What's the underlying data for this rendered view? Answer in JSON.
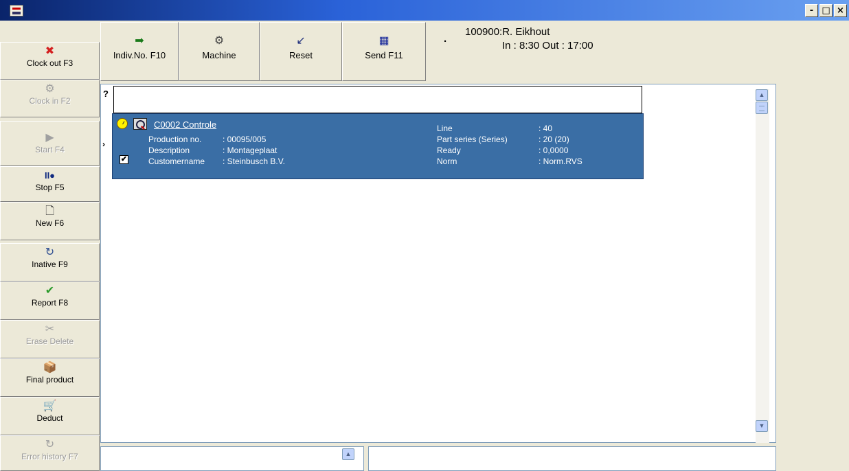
{
  "window": {
    "min_label": "-",
    "max_label": "□",
    "close_label": "×"
  },
  "sidebar": {
    "buttons": [
      {
        "label": "Clock out F3",
        "icon": "✖",
        "color": "#d42020",
        "enabled": true
      },
      {
        "label": "Clock in F2",
        "icon": "⚙",
        "color": "#a0a0a0",
        "enabled": false
      },
      {
        "label": "Start F4",
        "icon": "▶",
        "color": "#a0a0a0",
        "enabled": false
      },
      {
        "label": "Stop F5",
        "icon": "II●",
        "color": "#102a80",
        "enabled": true
      },
      {
        "label": "New F6",
        "icon": "🗋",
        "color": "#333333",
        "enabled": true
      },
      {
        "label": "Inative F9",
        "icon": "↻",
        "color": "#2a4a90",
        "enabled": true
      },
      {
        "label": "Report F8",
        "icon": "✔",
        "color": "#2a9a2a",
        "enabled": true
      },
      {
        "label": "Erase Delete",
        "icon": "✂",
        "color": "#a0a0a0",
        "enabled": false
      },
      {
        "label": "Final product",
        "icon": "📦",
        "color": "#333333",
        "enabled": true
      },
      {
        "label": "Deduct",
        "icon": "🛒",
        "color": "#333333",
        "enabled": true
      },
      {
        "label": "Error history F7",
        "icon": "↻",
        "color": "#a0a0a0",
        "enabled": false
      }
    ]
  },
  "toolbar": {
    "buttons": [
      {
        "label": "Indiv.No. F10",
        "icon": "➡",
        "color": "#1a7a1a"
      },
      {
        "label": "Machine",
        "icon": "⚙",
        "color": "#444444"
      },
      {
        "label": "Reset",
        "icon": "↙",
        "color": "#1a2a7a"
      },
      {
        "label": "Send F11",
        "icon": "▦",
        "color": "#1a2a9a"
      }
    ]
  },
  "header": {
    "dot": "·",
    "employee": "100900:R. Eikhout",
    "hours": "In : 8:30 Out : 17:00"
  },
  "list": {
    "question": "?",
    "arrow": "›",
    "card": {
      "title": "C0002 Controle",
      "checked": "✔",
      "left": [
        {
          "key": "Production no.",
          "value": ": 00095/005"
        },
        {
          "key": "Description",
          "value": ": Montageplaat"
        },
        {
          "key": "Customername",
          "value": ": Steinbusch B.V."
        }
      ],
      "right": [
        {
          "key": "Line",
          "value": ": 40"
        },
        {
          "key": "Part series (Series)",
          "value": ": 20 (20)"
        },
        {
          "key": "Ready",
          "value": ": 0,0000"
        },
        {
          "key": "Norm",
          "value": ": Norm.RVS"
        }
      ]
    }
  },
  "scroll": {
    "up": "▲",
    "down": "▼"
  }
}
